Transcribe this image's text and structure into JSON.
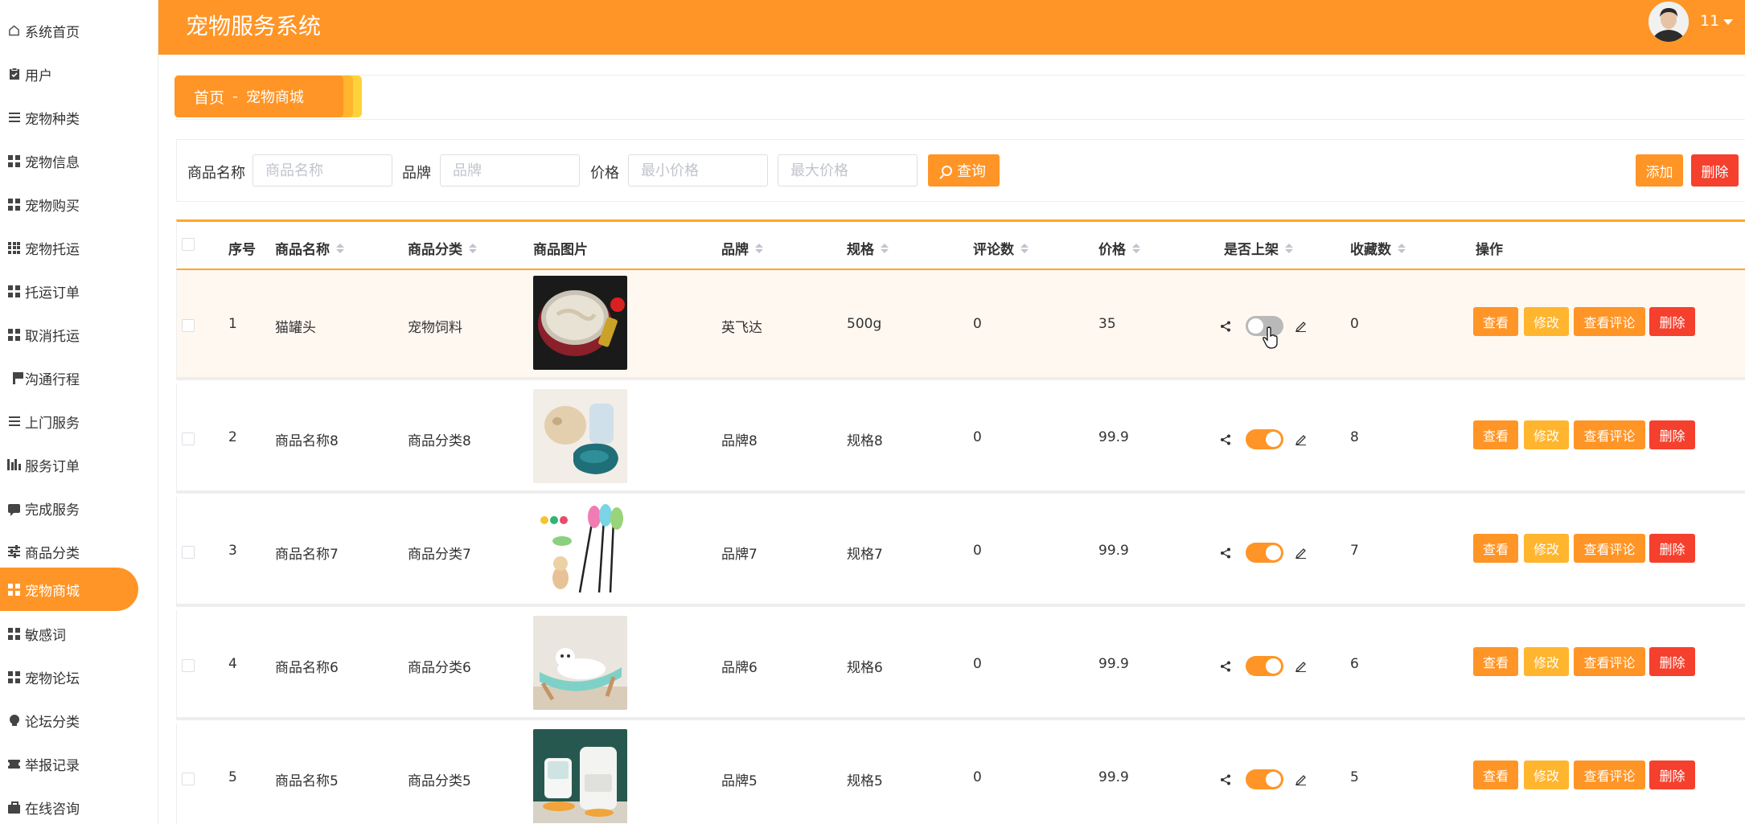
{
  "header": {
    "title": "宠物服务系统",
    "username": "11"
  },
  "sidebar": {
    "items": [
      {
        "label": "系统首页",
        "icon": "home-icon"
      },
      {
        "label": "用户",
        "icon": "clipboard-check-icon"
      },
      {
        "label": "宠物种类",
        "icon": "list-icon"
      },
      {
        "label": "宠物信息",
        "icon": "grid-icon"
      },
      {
        "label": "宠物购买",
        "icon": "grid-icon"
      },
      {
        "label": "宠物托运",
        "icon": "apps-icon"
      },
      {
        "label": "托运订单",
        "icon": "grid-icon"
      },
      {
        "label": "取消托运",
        "icon": "grid-icon"
      },
      {
        "label": "沟通行程",
        "icon": "flag-icon"
      },
      {
        "label": "上门服务",
        "icon": "list-icon"
      },
      {
        "label": "服务订单",
        "icon": "bar-chart-icon"
      },
      {
        "label": "完成服务",
        "icon": "chat-icon"
      },
      {
        "label": "商品分类",
        "icon": "sliders-icon"
      },
      {
        "label": "宠物商城",
        "icon": "grid-icon",
        "active": true
      },
      {
        "label": "敏感词",
        "icon": "grid-icon"
      },
      {
        "label": "宠物论坛",
        "icon": "grid-icon"
      },
      {
        "label": "论坛分类",
        "icon": "bulb-icon"
      },
      {
        "label": "举报记录",
        "icon": "ticket-icon"
      },
      {
        "label": "在线咨询",
        "icon": "briefcase-icon"
      }
    ]
  },
  "breadcrumb": {
    "home": "首页",
    "separator": "-",
    "current": "宠物商城"
  },
  "search": {
    "name_label": "商品名称",
    "name_placeholder": "商品名称",
    "brand_label": "品牌",
    "brand_placeholder": "品牌",
    "price_label": "价格",
    "min_price_placeholder": "最小价格",
    "max_price_placeholder": "最大价格",
    "search_button": "查询",
    "add_button": "添加",
    "delete_button": "删除"
  },
  "table": {
    "columns": {
      "index": "序号",
      "name": "商品名称",
      "category": "商品分类",
      "image": "商品图片",
      "brand": "品牌",
      "spec": "规格",
      "comments": "评论数",
      "price": "价格",
      "on_shelf": "是否上架",
      "favorites": "收藏数",
      "actions": "操作"
    },
    "action_labels": {
      "view": "查看",
      "edit": "修改",
      "view_comments": "查看评论",
      "delete": "删除"
    },
    "rows": [
      {
        "index": "1",
        "name": "猫罐头",
        "category": "宠物饲料",
        "image": "cat-food-can",
        "brand": "英飞达",
        "spec": "500g",
        "comments": "0",
        "price": "35",
        "on_shelf": false,
        "favorites": "0"
      },
      {
        "index": "2",
        "name": "商品名称8",
        "category": "商品分类8",
        "image": "pet-water-dispenser",
        "brand": "品牌8",
        "spec": "规格8",
        "comments": "0",
        "price": "99.9",
        "on_shelf": true,
        "favorites": "8"
      },
      {
        "index": "3",
        "name": "商品名称7",
        "category": "商品分类7",
        "image": "feather-cat-teaser",
        "brand": "品牌7",
        "spec": "规格7",
        "comments": "0",
        "price": "99.9",
        "on_shelf": true,
        "favorites": "7"
      },
      {
        "index": "4",
        "name": "商品名称6",
        "category": "商品分类6",
        "image": "cat-hammock-bed",
        "brand": "品牌6",
        "spec": "规格6",
        "comments": "0",
        "price": "99.9",
        "on_shelf": true,
        "favorites": "6"
      },
      {
        "index": "5",
        "name": "商品名称5",
        "category": "商品分类5",
        "image": "automatic-feeder",
        "brand": "品牌5",
        "spec": "规格5",
        "comments": "0",
        "price": "99.9",
        "on_shelf": true,
        "favorites": "5"
      }
    ]
  },
  "colors": {
    "primary": "#ff9526",
    "secondary": "#ffb52e",
    "danger": "#f5402d",
    "switch_off": "#b9b9b9"
  }
}
